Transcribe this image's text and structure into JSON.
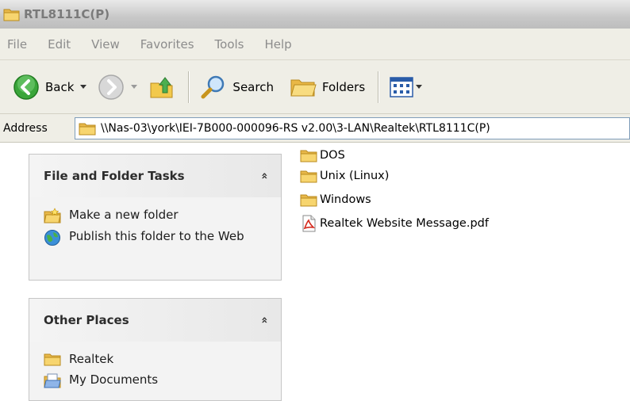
{
  "window": {
    "title": "RTL8111C(P)",
    "title_icon": "folder-icon"
  },
  "menu": {
    "items": [
      "File",
      "Edit",
      "View",
      "Favorites",
      "Tools",
      "Help"
    ]
  },
  "toolbar": {
    "back_label": "Back",
    "search_label": "Search",
    "folders_label": "Folders"
  },
  "address": {
    "label": "Address",
    "path": "\\\\Nas-03\\york\\IEI-7B000-000096-RS v2.00\\3-LAN\\Realtek\\RTL8111C(P)"
  },
  "file_tasks": {
    "title": "File and Folder Tasks",
    "collapse": "»",
    "items": [
      {
        "label": "Make a new folder",
        "icon": "new-folder-icon"
      },
      {
        "label": "Publish this folder to the Web",
        "icon": "publish-web-icon"
      }
    ]
  },
  "other_places": {
    "title": "Other Places",
    "collapse": "»",
    "items": [
      {
        "label": "Realtek",
        "icon": "folder-icon"
      },
      {
        "label": "My Documents",
        "icon": "my-documents-icon"
      }
    ]
  },
  "files": [
    {
      "name": "DOS",
      "icon": "folder-icon"
    },
    {
      "name": "Unix (Linux)",
      "icon": "folder-icon"
    },
    {
      "name": "Windows",
      "icon": "folder-icon"
    },
    {
      "name": "Realtek Website Message.pdf",
      "icon": "pdf-icon"
    }
  ],
  "colors": {
    "folder_yellow": "#f5d36a",
    "address_border": "#7f9db9",
    "back_green": "#3aa53a"
  }
}
